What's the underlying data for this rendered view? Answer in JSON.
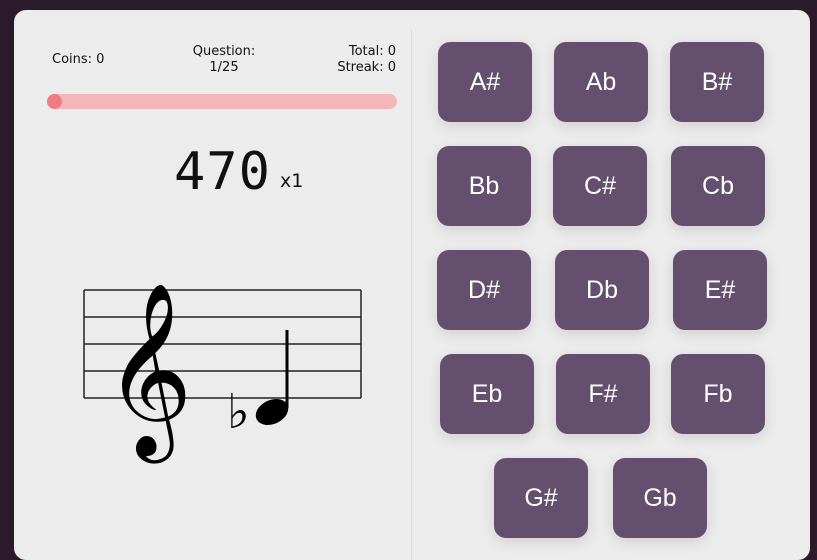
{
  "stats": {
    "coins": "Coins: 0",
    "question_label": "Question:",
    "question_value": "1/25",
    "total": "Total: 0",
    "streak": "Streak: 0"
  },
  "progress": {
    "fraction": 0.04
  },
  "score": {
    "value": "470",
    "multiplier": "x1"
  },
  "staff": {
    "clef": "treble",
    "note": "Db",
    "accidental": "flat"
  },
  "answers": [
    "A#",
    "Ab",
    "B#",
    "Bb",
    "C#",
    "Cb",
    "D#",
    "Db",
    "E#",
    "Eb",
    "F#",
    "Fb",
    "G#",
    "Gb"
  ],
  "colors": {
    "button": "#654f6f",
    "progress_track": "#f4b6b9",
    "progress_fill": "#ef7c83",
    "panel": "#ececec",
    "background": "#2a1a2a"
  }
}
